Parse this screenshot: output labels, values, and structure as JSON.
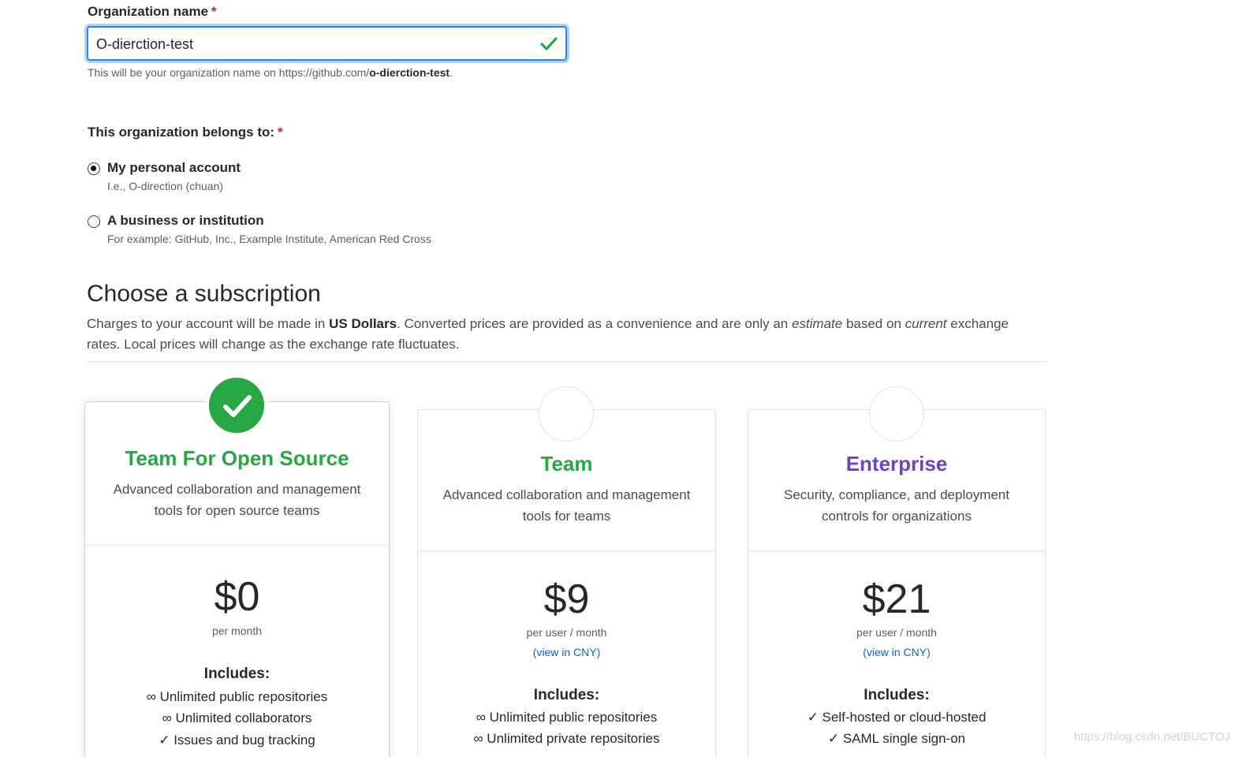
{
  "org_name": {
    "label": "Organization name",
    "required_mark": "*",
    "value": "O-dierction-test",
    "hint_prefix": "This will be your organization name on https://github.com/",
    "hint_slug": "o-dierction-test",
    "hint_suffix": "."
  },
  "belongs": {
    "label": "This organization belongs to:",
    "required_mark": "*",
    "options": [
      {
        "title": "My personal account",
        "note": "I.e., O-direction (chuan)",
        "checked": true
      },
      {
        "title": "A business or institution",
        "note": "For example: GitHub, Inc., Example Institute, American Red Cross",
        "checked": false
      }
    ]
  },
  "subscription": {
    "title": "Choose a subscription",
    "desc_1": "Charges to your account will be made in ",
    "desc_bold": "US Dollars",
    "desc_2": ". Converted prices are provided as a convenience and are only an ",
    "desc_em1": "estimate",
    "desc_3": " based on ",
    "desc_em2": "current",
    "desc_4": " exchange rates. Local prices will change as the exchange rate fluctuates."
  },
  "plans": [
    {
      "name": "Team For Open Source",
      "name_color": "#28a745",
      "desc_line1": "Advanced collaboration and management",
      "desc_line2": "tools for open source teams",
      "price": "$0",
      "period": "per month",
      "includes": "Includes:",
      "features": [
        "∞ Unlimited public repositories",
        "∞ Unlimited collaborators",
        "✓ Issues and bug tracking"
      ],
      "selected": true
    },
    {
      "name": "Team",
      "name_color": "#28a745",
      "desc_line1": "Advanced collaboration and management",
      "desc_line2": "tools for teams",
      "price": "$9",
      "period": "per user / month",
      "currency_link": "(view in CNY)",
      "includes": "Includes:",
      "features": [
        "∞ Unlimited public repositories",
        "∞ Unlimited private repositories"
      ],
      "selected": false
    },
    {
      "name": "Enterprise",
      "name_color": "#6f42c1",
      "desc_line1": "Security, compliance, and deployment",
      "desc_line2": "controls for organizations",
      "price": "$21",
      "period": "per user / month",
      "currency_link": "(view in CNY)",
      "includes": "Includes:",
      "features": [
        "✓ Self-hosted or cloud-hosted",
        "✓ SAML single sign-on"
      ],
      "selected": false
    }
  ],
  "icons": {
    "valid": "check-icon",
    "selected_plan": "check-circle-icon"
  },
  "colors": {
    "accent_blue": "#0366d6",
    "success_green": "#28a745",
    "enterprise_purple": "#6f42c1",
    "required_red": "#cb2431"
  },
  "watermark": "https://blog.csdn.net/BUCTOJ"
}
